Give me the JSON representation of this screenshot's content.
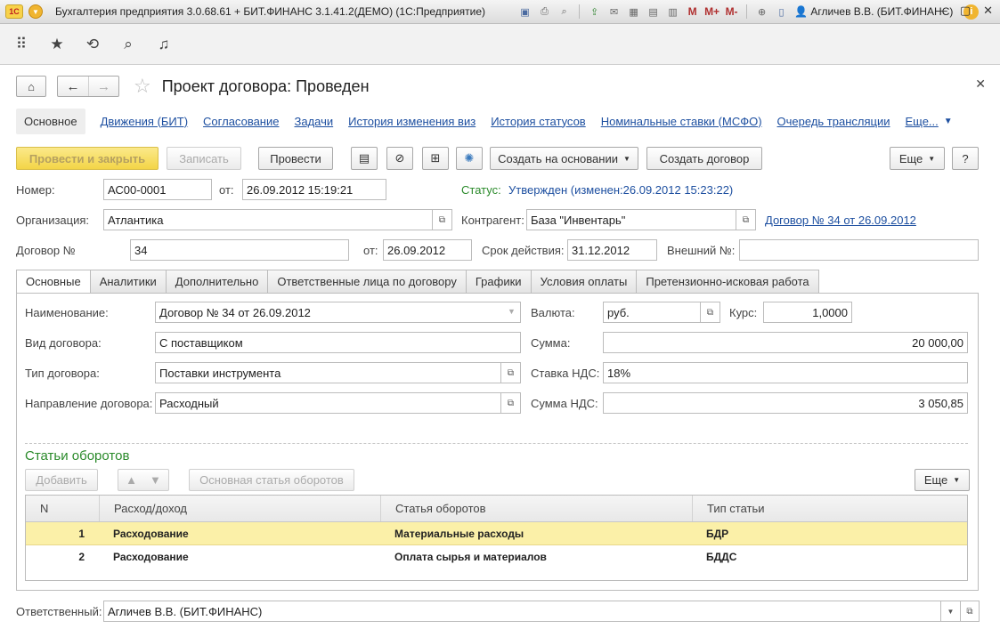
{
  "app": {
    "title": "Бухгалтерия предприятия 3.0.68.61 + БИТ.ФИНАНС 3.1.41.2(ДЕМО)  (1С:Предприятие)",
    "logo_text": "1С",
    "user": "Агличев В.В. (БИТ.ФИНАНС)",
    "toolbar_letters": [
      "M",
      "M+",
      "M-"
    ]
  },
  "form": {
    "title": "Проект договора: Проведен",
    "links": [
      "Основное",
      "Движения (БИТ)",
      "Согласование",
      "Задачи",
      "История изменения виз",
      "История статусов",
      "Номинальные ставки (МСФО)",
      "Очередь трансляции"
    ],
    "links_more": "Еще..."
  },
  "commands": {
    "post_close": "Провести и закрыть",
    "save": "Записать",
    "post": "Провести",
    "create_based": "Создать на основании",
    "create_contract": "Создать договор",
    "more": "Еще",
    "help": "?"
  },
  "header": {
    "number_label": "Номер:",
    "number": "АС00-0001",
    "from_label": "от:",
    "date": "26.09.2012 15:19:21",
    "status_label": "Статус:",
    "status_value": "Утвержден (изменен:26.09.2012 15:23:22)",
    "org_label": "Организация:",
    "org": "Атлантика",
    "contractor_label": "Контрагент:",
    "contractor": "База \"Инвентарь\"",
    "contract_link": "Договор № 34 от 26.09.2012",
    "contract_no_label": "Договор №",
    "contract_no": "34",
    "contract_from_label": "от:",
    "contract_date": "26.09.2012",
    "validity_label": "Срок действия:",
    "validity": "31.12.2012",
    "external_label": "Внешний №:",
    "external": ""
  },
  "tabs": [
    "Основные",
    "Аналитики",
    "Дополнительно",
    "Ответственные лица по договору",
    "Графики",
    "Условия оплаты",
    "Претензионно-исковая работа"
  ],
  "main": {
    "name_label": "Наименование:",
    "name": "Договор № 34 от 26.09.2012",
    "kind_label": "Вид договора:",
    "kind": "С поставщиком",
    "type_label": "Тип договора:",
    "type": "Поставки инструмента",
    "direction_label": "Направление договора:",
    "direction": "Расходный",
    "currency_label": "Валюта:",
    "currency": "руб.",
    "rate_label": "Курс:",
    "rate": "1,0000",
    "sum_label": "Сумма:",
    "sum": "20 000,00",
    "vat_rate_label": "Ставка НДС:",
    "vat_rate": "18%",
    "vat_sum_label": "Сумма НДС:",
    "vat_sum": "3 050,85"
  },
  "turnover": {
    "title": "Статьи оборотов",
    "add": "Добавить",
    "main_item": "Основная статья оборотов",
    "more": "Еще",
    "columns": [
      "N",
      "Расход/доход",
      "Статья оборотов",
      "Тип статьи"
    ],
    "rows": [
      {
        "n": "1",
        "kind": "Расходование",
        "item": "Материальные расходы",
        "type": "БДР"
      },
      {
        "n": "2",
        "kind": "Расходование",
        "item": "Оплата сырья и материалов",
        "type": "БДДС"
      }
    ]
  },
  "footer": {
    "responsible_label": "Ответственный:",
    "responsible": "Агличев В.В. (БИТ.ФИНАНС)"
  },
  "colors": {
    "primary_button": "#f3d547",
    "link": "#1d4fa0",
    "status": "#2a8a2a",
    "selected_row": "#fbf0a8"
  }
}
